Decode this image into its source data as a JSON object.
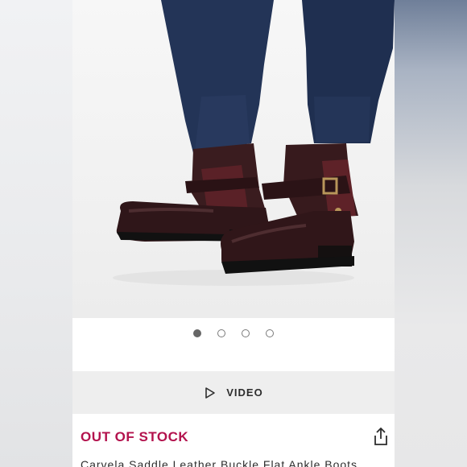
{
  "carousel": {
    "dot_count": 4,
    "active_index": 0
  },
  "video": {
    "label": "VIDEO",
    "icon": "play-icon"
  },
  "product": {
    "stock_status": "OUT OF STOCK",
    "title": "Carvela Saddle Leather Buckle Flat Ankle Boots",
    "share_icon": "share-icon"
  },
  "colors": {
    "stock_status": "#b3124d",
    "video_bar": "#eeeeee",
    "boot_leather": "#3a1c1f"
  }
}
